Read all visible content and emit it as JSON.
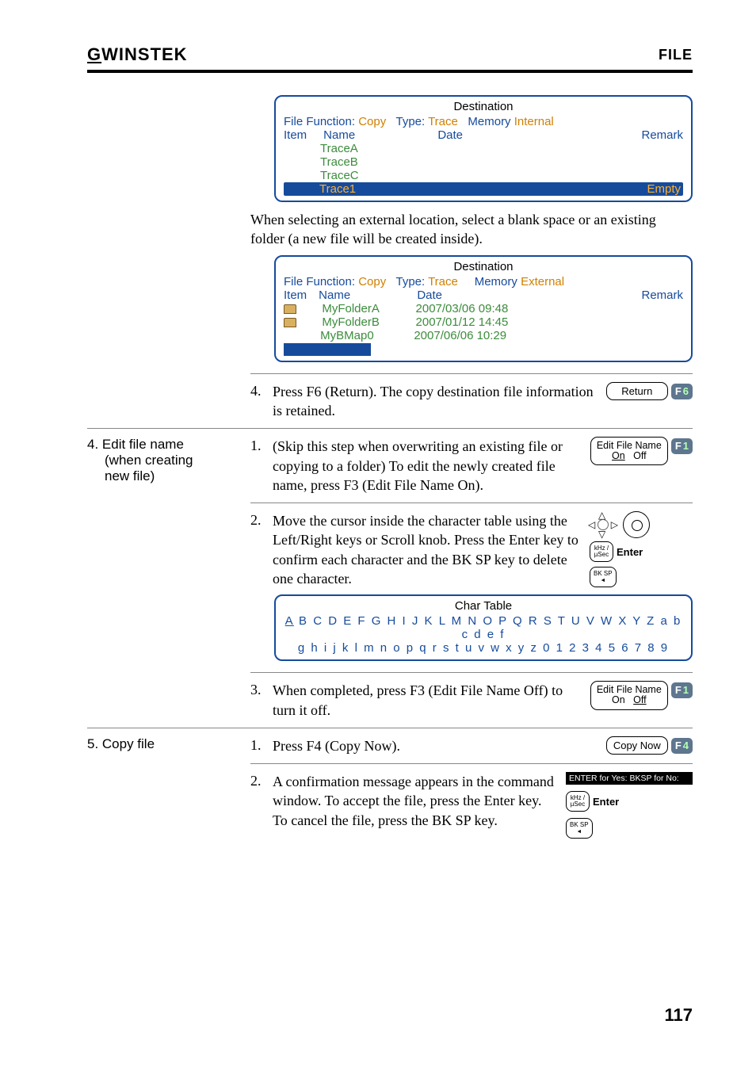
{
  "header": {
    "logo": "GWINSTEK",
    "page_label": "FILE"
  },
  "box1": {
    "title": "Destination",
    "l1_a": "File Function:",
    "l1_b": "Copy",
    "l1_c": "Type:",
    "l1_d": "Trace",
    "l1_e": "Memory",
    "l1_f": "Internal",
    "h1": "Item",
    "h2": "Name",
    "h3": "Date",
    "h4": "Remark",
    "n1": "TraceA",
    "n2": "TraceB",
    "n3": "TraceC",
    "row_name": "Trace1",
    "row_remark": "Empty"
  },
  "para1": "When selecting an external location, select a blank space or an existing folder (a new file will be created inside).",
  "box2": {
    "title": "Destination",
    "l1_a": "File Function:",
    "l1_b": "Copy",
    "l1_c": "Type:",
    "l1_d": "Trace",
    "l1_e": "Memory",
    "l1_f": "External",
    "h1": "Item",
    "h2": "Name",
    "h3": "Date",
    "h4": "Remark",
    "f1": "MyFolderA",
    "d1": "2007/03/06 09:48",
    "f2": "MyFolderB",
    "d2": "2007/01/12 14:45",
    "f3": "MyBMap0",
    "d3": "2007/06/06 10:29"
  },
  "step4": {
    "text": "Press F6 (Return). The copy destination file information is retained.",
    "key": "Return",
    "f": "F",
    "n": "6"
  },
  "sec4": {
    "title1": "4.  Edit file name",
    "title2": "(when creating",
    "title3": "new file)"
  },
  "s4_1": {
    "text": "(Skip this step when overwriting an existing file or copying to a folder) To edit the newly created file name, press F3 (Edit File Name On).",
    "k1": "Edit File Name",
    "k2a": "On",
    "k2b": "Off",
    "f": "F",
    "n": "1"
  },
  "s4_2": {
    "text": "Move the cursor inside the character table using the Left/Right keys or Scroll knob. Press the Enter key to confirm each character and the BK SP key to delete one character.",
    "enter": "Enter"
  },
  "chartable": {
    "title": "Char Table",
    "row1a": "A",
    "row1b": "B C D E F G H I J K L M N O P Q R S T U V W X Y Z a b c d e f",
    "row2": "g h i j k l m n o p q r s t u v w x y z 0 1 2 3 4 5 6 7 8 9"
  },
  "s4_3": {
    "text": "When completed, press F3 (Edit File Name Off) to turn it off.",
    "k1": "Edit File Name",
    "k2a": "On",
    "k2b": "Off",
    "f": "F",
    "n": "1"
  },
  "sec5": {
    "title": "5. Copy file"
  },
  "s5_1": {
    "text": "Press F4 (Copy Now).",
    "key": "Copy Now",
    "f": "F",
    "n": "4"
  },
  "s5_2": {
    "text": "A confirmation message appears in the command window. To accept the file, press the Enter key. To cancel the file, press the BK SP key.",
    "confirm": "ENTER for Yes: BKSP for No:",
    "enter": "Enter"
  },
  "pagenum": "117"
}
